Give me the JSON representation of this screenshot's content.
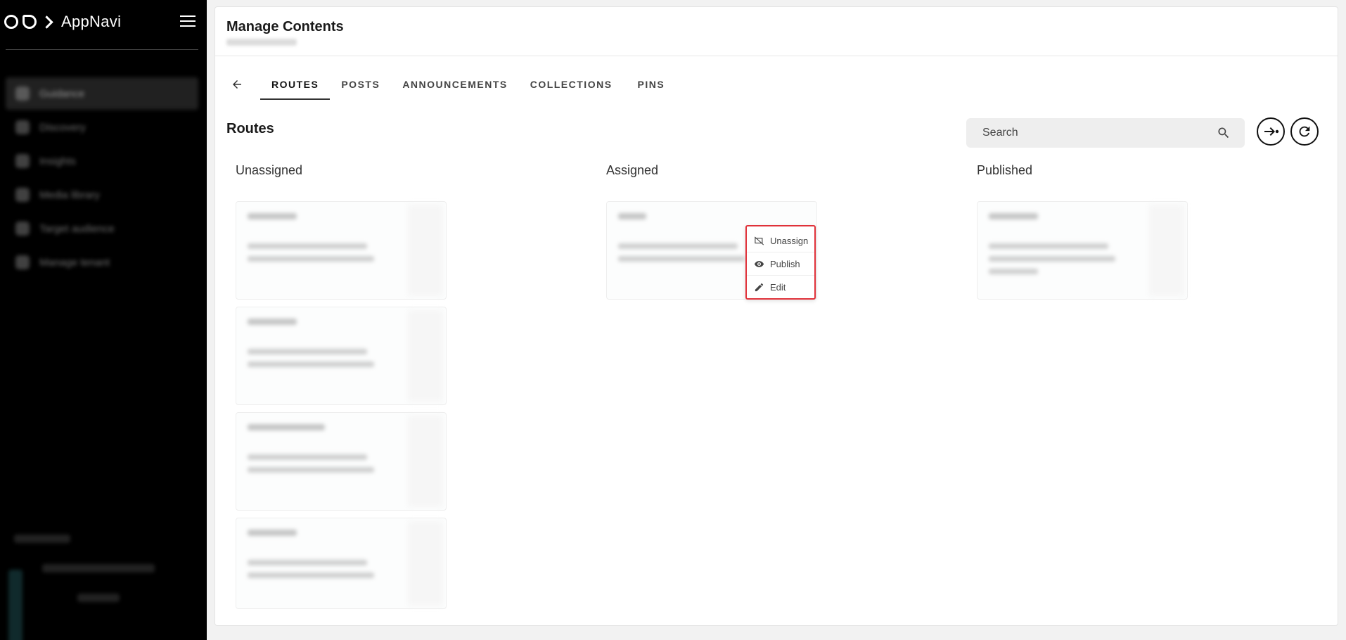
{
  "app": {
    "name": "AppNavi"
  },
  "sidebar": {
    "items": [
      {
        "label": "Guidance",
        "icon": "guidance-icon",
        "active": true
      },
      {
        "label": "Discovery",
        "icon": "search-icon",
        "active": false
      },
      {
        "label": "Insights",
        "icon": "insights-icon",
        "active": false
      },
      {
        "label": "Media library",
        "icon": "image-icon",
        "active": false
      },
      {
        "label": "Target audience",
        "icon": "target-icon",
        "active": false
      },
      {
        "label": "Manage tenant",
        "icon": "settings-icon",
        "active": false
      }
    ]
  },
  "header": {
    "title": "Manage Contents"
  },
  "tabs": [
    {
      "label": "ROUTES",
      "active": true
    },
    {
      "label": "POSTS",
      "active": false
    },
    {
      "label": "ANNOUNCEMENTS",
      "active": false
    },
    {
      "label": "COLLECTIONS",
      "active": false
    },
    {
      "label": "PINS",
      "active": false
    }
  ],
  "section": {
    "title": "Routes"
  },
  "search": {
    "placeholder": "Search",
    "value": ""
  },
  "columns": {
    "unassigned": {
      "title": "Unassigned"
    },
    "assigned": {
      "title": "Assigned"
    },
    "published": {
      "title": "Published"
    }
  },
  "context_menu": {
    "items": [
      {
        "label": "Unassign",
        "icon": "unassign-icon"
      },
      {
        "label": "Publish",
        "icon": "eye-icon"
      },
      {
        "label": "Edit",
        "icon": "pencil-icon"
      }
    ]
  },
  "colors": {
    "sidebar_bg": "#000000",
    "menu_highlight": "#e0323a",
    "search_bg": "#eeeeee"
  }
}
